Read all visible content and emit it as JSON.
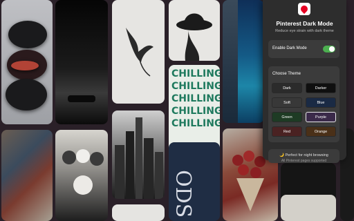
{
  "popup": {
    "logo_icon": "pinterest-pin-icon",
    "title": "Pinterest Dark Mode",
    "subtitle": "Reduce eye strain with dark theme",
    "toggle": {
      "label": "Enable Dark Mode",
      "enabled": true,
      "on_color": "#4caf50"
    },
    "theme": {
      "heading": "Choose Theme",
      "options": [
        {
          "label": "Dark",
          "color": "#2b2b2b",
          "selected": false
        },
        {
          "label": "Darker",
          "color": "#0f0f0f",
          "selected": false
        },
        {
          "label": "Soft",
          "color": "#383838",
          "selected": false
        },
        {
          "label": "Blue",
          "color": "#1a2a44",
          "selected": false
        },
        {
          "label": "Green",
          "color": "#1e3b24",
          "selected": false
        },
        {
          "label": "Purple",
          "color": "#3b2a4a",
          "selected": true
        },
        {
          "label": "Red",
          "color": "#4a2222",
          "selected": false
        },
        {
          "label": "Orange",
          "color": "#4a3018",
          "selected": false
        }
      ]
    },
    "tip": "🌙 Perfect for night browsing",
    "tip_sub": "All Pinterest pages supported"
  },
  "pins": {
    "chilling_repeat": [
      "CHILLING",
      "CHILLING",
      "CHILLING",
      "CHILLING",
      "CHILLING"
    ],
    "navy_text": "ODS"
  }
}
